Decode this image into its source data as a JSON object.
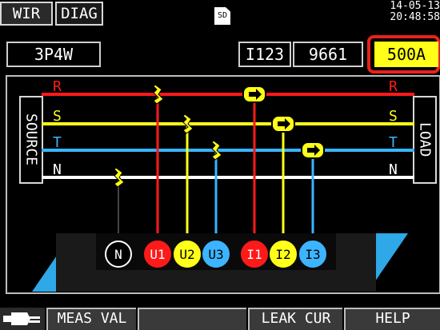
{
  "header": {
    "tabs": [
      {
        "label": "WIR"
      },
      {
        "label": "DIAG"
      }
    ],
    "sd_label": "SD",
    "date": "14-05-13",
    "time": "20:48:58"
  },
  "status": {
    "wiring": "3P4W",
    "clamp_label": "I123",
    "clamp_model": "9661",
    "current_range": "500A"
  },
  "diagram": {
    "source_label": "SOURCE",
    "load_label": "LOAD",
    "lines": [
      {
        "name": "R",
        "color": "#ff1a1a"
      },
      {
        "name": "S",
        "color": "#ffff1a"
      },
      {
        "name": "T",
        "color": "#3cb4ff"
      },
      {
        "name": "N",
        "color": "#ffffff"
      }
    ],
    "terminals": [
      {
        "label": "N",
        "color": "#000000"
      },
      {
        "label": "U1",
        "color": "#ff1a1a"
      },
      {
        "label": "U2",
        "color": "#ffff1a"
      },
      {
        "label": "U3",
        "color": "#3cb4ff"
      },
      {
        "label": "I1",
        "color": "#ff1a1a"
      },
      {
        "label": "I2",
        "color": "#ffff1a"
      },
      {
        "label": "I3",
        "color": "#3cb4ff"
      }
    ]
  },
  "footer": {
    "keys": [
      {
        "label": "MEAS VAL"
      },
      {
        "label": ""
      },
      {
        "label": "LEAK CUR"
      },
      {
        "label": "HELP"
      }
    ]
  },
  "colors": {
    "background": "#000000",
    "highlight_box": "#e8221c",
    "range_box_bg": "#ffff1a",
    "sensor_block": "#2ea8e6"
  }
}
